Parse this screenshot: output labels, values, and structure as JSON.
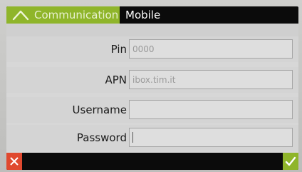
{
  "header": {
    "back_label": "Communication",
    "title": "Mobile",
    "back_icon": "chevron-up-icon"
  },
  "form": {
    "fields": [
      {
        "label": "Pin",
        "value": "",
        "placeholder": "0000"
      },
      {
        "label": "APN",
        "value": "",
        "placeholder": "ibox.tim.it"
      },
      {
        "label": "Username",
        "value": "",
        "placeholder": ""
      },
      {
        "label": "Password",
        "value": "",
        "placeholder": ""
      }
    ]
  },
  "footer": {
    "cancel_icon": "close-icon",
    "confirm_icon": "check-icon"
  },
  "colors": {
    "accent": "#8fb52a",
    "cancel": "#e0492f",
    "bar": "#0b0b0b"
  }
}
